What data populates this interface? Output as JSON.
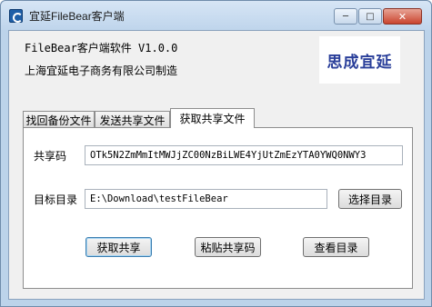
{
  "window": {
    "title": "宜延FileBear客户端",
    "minimize_glyph": "─",
    "maximize_glyph": "□",
    "close_glyph": "✕"
  },
  "header": {
    "app_version": "FileBear客户端软件 V1.0.0",
    "company": "上海宜延电子商务有限公司制造",
    "logo_text": "思成宜延"
  },
  "tabs": [
    {
      "label": "找回备份文件",
      "active": false
    },
    {
      "label": "发送共享文件",
      "active": false
    },
    {
      "label": "获取共享文件",
      "active": true
    }
  ],
  "form": {
    "share_code_label": "共享码",
    "share_code_value": "OTk5N2ZmMmItMWJjZC00NzBiLWE4YjUtZmEzYTA0YWQ0NWY3",
    "target_dir_label": "目标目录",
    "target_dir_value": "E:\\Download\\testFileBear",
    "choose_dir_button": "选择目录"
  },
  "actions": {
    "get_share": "获取共享",
    "paste_code": "粘贴共享码",
    "view_dir": "查看目录"
  },
  "colors": {
    "frame": "#bcd3ea",
    "close_button": "#c9442e",
    "logo": "#2a3f9a"
  }
}
